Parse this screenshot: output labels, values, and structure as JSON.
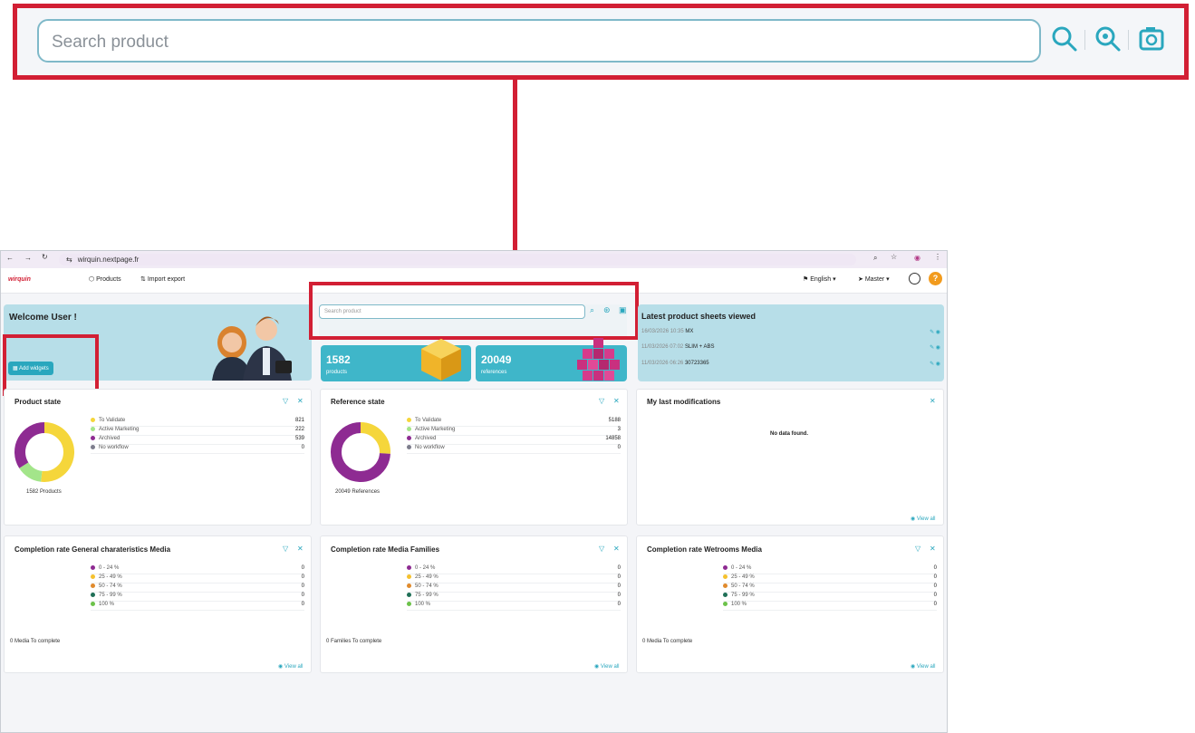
{
  "zoom_callout": {
    "search_placeholder": "Search product",
    "icons": [
      "search-icon",
      "advanced-search-icon",
      "image-search-icon"
    ]
  },
  "browser": {
    "url": "wirquin.nextpage.fr",
    "nav_icons": [
      "back-icon",
      "forward-icon",
      "reload-icon",
      "site-settings-icon"
    ],
    "right_icons": [
      "zoom-icon",
      "bookmark-star-icon",
      "profile-icon",
      "menu-icon"
    ]
  },
  "app": {
    "logo": "wirquin",
    "nav": [
      {
        "label": "Products",
        "icon": "cube-icon"
      },
      {
        "label": "Import export",
        "icon": "import-export-icon"
      }
    ],
    "language": "English",
    "catalog": "Master",
    "help_symbol": "?"
  },
  "welcome": {
    "title": "Welcome User !",
    "add_widgets": "Add widgets"
  },
  "search": {
    "placeholder": "Search product"
  },
  "stats": {
    "products_count": "1582",
    "products_label": "products",
    "references_count": "20049",
    "references_label": "references"
  },
  "latest": {
    "title": "Latest product sheets viewed",
    "items": [
      {
        "date": "16/03/2026 10:35",
        "name": "MX"
      },
      {
        "date": "11/03/2026 07:02",
        "name": "SLIM + ABS"
      },
      {
        "date": "11/03/2026 06:26",
        "name": "30723365"
      }
    ]
  },
  "product_state": {
    "title": "Product state",
    "legend": [
      {
        "label": "To Validate",
        "value": "821",
        "color": "#f5d63b"
      },
      {
        "label": "Active Marketing",
        "value": "222",
        "color": "#a3e58a"
      },
      {
        "label": "Archived",
        "value": "539",
        "color": "#8e2b92"
      },
      {
        "label": "No workflow",
        "value": "0",
        "color": "#7d7d8c"
      }
    ],
    "total": "1582 Products"
  },
  "reference_state": {
    "title": "Reference state",
    "legend": [
      {
        "label": "To Validate",
        "value": "5188",
        "color": "#f5d63b"
      },
      {
        "label": "Active Marketing",
        "value": "3",
        "color": "#a3e58a"
      },
      {
        "label": "Archived",
        "value": "14858",
        "color": "#8e2b92"
      },
      {
        "label": "No workflow",
        "value": "0",
        "color": "#7d7d8c"
      }
    ],
    "total": "20049 References"
  },
  "last_modifications": {
    "title": "My last modifications",
    "empty": "No data found.",
    "view_all": "View all"
  },
  "completion_general": {
    "title": "Completion rate General charateristics Media",
    "footer": "0 Media To complete",
    "view_all": "View all"
  },
  "completion_families": {
    "title": "Completion rate Media Families",
    "footer": "0 Families To complete",
    "view_all": "View all"
  },
  "completion_wetrooms": {
    "title": "Completion rate Wetrooms Media",
    "footer": "0 Media To complete",
    "view_all": "View all"
  },
  "completion_legend": [
    {
      "label": "0 - 24 %",
      "value": "0",
      "color": "#8e2b92"
    },
    {
      "label": "25 - 49 %",
      "value": "0",
      "color": "#f5c12e"
    },
    {
      "label": "50 - 74 %",
      "value": "0",
      "color": "#e08a2c"
    },
    {
      "label": "75 - 99 %",
      "value": "0",
      "color": "#1f6f56"
    },
    {
      "label": "100 %",
      "value": "0",
      "color": "#6cc24a"
    }
  ],
  "chart_data": [
    {
      "type": "pie",
      "title": "Product state",
      "categories": [
        "To Validate",
        "Active Marketing",
        "Archived",
        "No workflow"
      ],
      "values": [
        821,
        222,
        539,
        0
      ]
    },
    {
      "type": "pie",
      "title": "Reference state",
      "categories": [
        "To Validate",
        "Active Marketing",
        "Archived",
        "No workflow"
      ],
      "values": [
        5188,
        3,
        14858,
        0
      ]
    }
  ]
}
